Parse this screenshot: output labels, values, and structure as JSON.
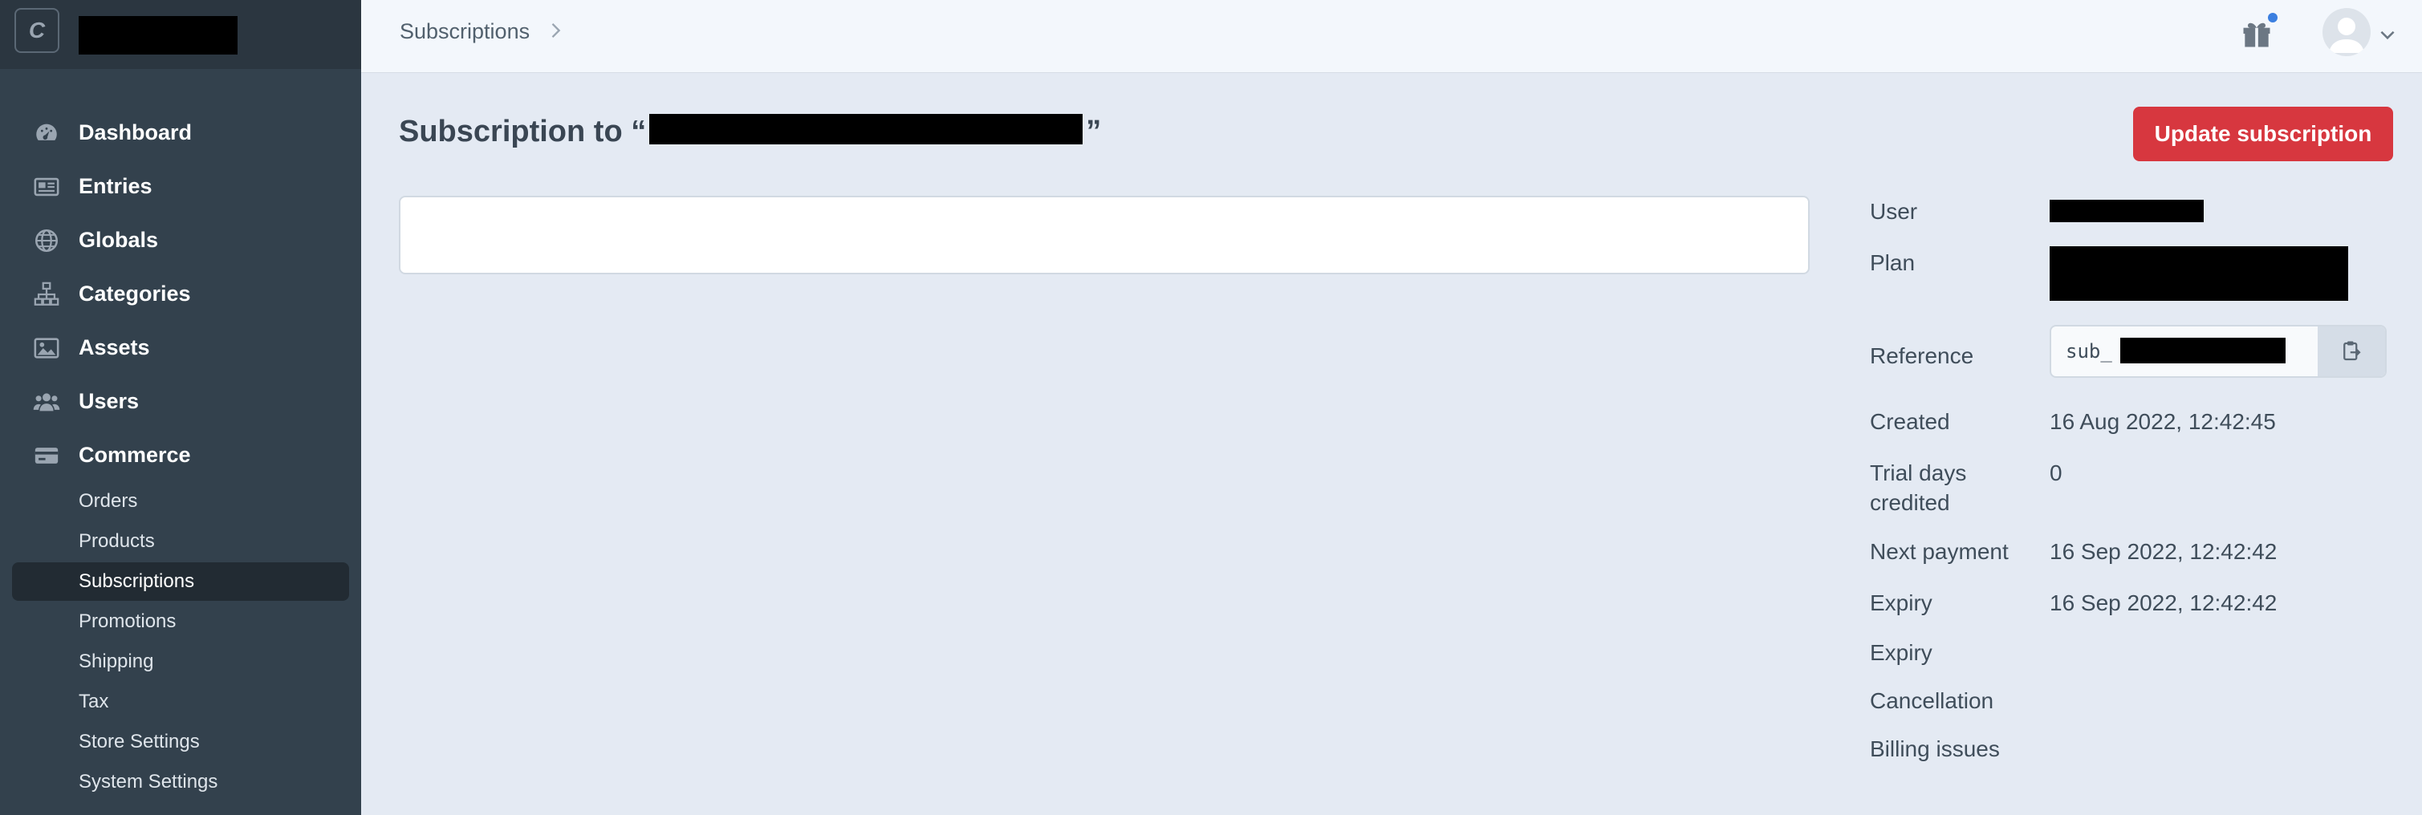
{
  "sidebar": {
    "logo_letter": "C",
    "nav": [
      {
        "label": "Dashboard",
        "icon": "dashboard-gauge-icon"
      },
      {
        "label": "Entries",
        "icon": "entries-icon"
      },
      {
        "label": "Globals",
        "icon": "globe-icon"
      },
      {
        "label": "Categories",
        "icon": "categories-tree-icon"
      },
      {
        "label": "Assets",
        "icon": "image-icon"
      },
      {
        "label": "Users",
        "icon": "users-icon"
      },
      {
        "label": "Commerce",
        "icon": "credit-card-icon"
      }
    ],
    "subnav": [
      {
        "label": "Orders"
      },
      {
        "label": "Products"
      },
      {
        "label": "Subscriptions",
        "active": true
      },
      {
        "label": "Promotions"
      },
      {
        "label": "Shipping"
      },
      {
        "label": "Tax"
      },
      {
        "label": "Store Settings"
      },
      {
        "label": "System Settings"
      }
    ]
  },
  "header": {
    "breadcrumb": "Subscriptions",
    "gift_icon": "gift-icon",
    "avatar_icon": "user-avatar-icon"
  },
  "main": {
    "title_prefix": "Subscription to “",
    "title_suffix": "”",
    "update_button": "Update subscription"
  },
  "meta": {
    "user_label": "User",
    "plan_label": "Plan",
    "reference_label": "Reference",
    "reference_prefix": "sub_",
    "created_label": "Created",
    "created_value": "16 Aug 2022, 12:42:45",
    "trial_label": "Trial days credited",
    "trial_value": "0",
    "next_payment_label": "Next payment",
    "next_payment_value": "16 Sep 2022, 12:42:42",
    "expiry_label": "Expiry",
    "expiry_value": "16 Sep 2022, 12:42:42",
    "expiry2_label": "Expiry",
    "cancellation_label": "Cancellation",
    "billing_label": "Billing issues"
  },
  "colors": {
    "sidebar_bg": "#33414d",
    "accent_red": "#d7373f",
    "page_bg": "#e4eaf3",
    "notification_dot": "#3b7fe0"
  }
}
